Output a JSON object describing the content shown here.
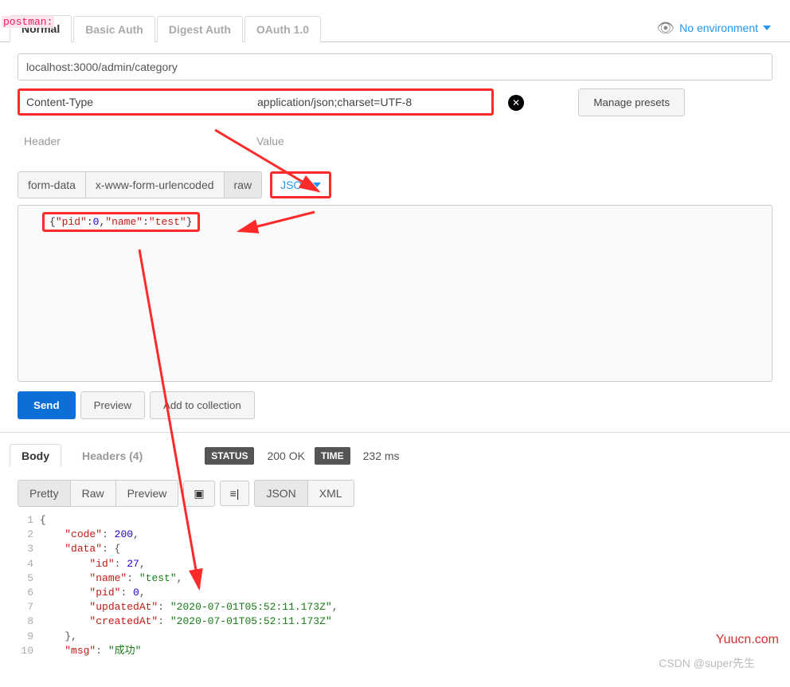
{
  "label": "postman:",
  "request_tabs": [
    "Normal",
    "Basic Auth",
    "Digest Auth",
    "OAuth 1.0"
  ],
  "env_label": "No environment",
  "url": "localhost:3000/admin/category",
  "header": {
    "key": "Content-Type",
    "value": "application/json;charset=UTF-8"
  },
  "placeholder": {
    "key": "Header",
    "value": "Value"
  },
  "manage_presets": "Manage presets",
  "body_types": [
    "form-data",
    "x-www-form-urlencoded",
    "raw"
  ],
  "body_format": "JSON",
  "body_raw_tokens": [
    {
      "t": "{",
      "c": "pun"
    },
    {
      "t": "\"pid\"",
      "c": "str"
    },
    {
      "t": ":",
      "c": "pun"
    },
    {
      "t": "0",
      "c": "num"
    },
    {
      "t": ",",
      "c": "pun"
    },
    {
      "t": "\"name\"",
      "c": "str"
    },
    {
      "t": ":",
      "c": "pun"
    },
    {
      "t": "\"test\"",
      "c": "str"
    },
    {
      "t": "}",
      "c": "pun"
    }
  ],
  "actions": {
    "send": "Send",
    "preview": "Preview",
    "add": "Add to collection"
  },
  "response_tabs": {
    "body": "Body",
    "headers": "Headers (4)"
  },
  "status": {
    "label": "STATUS",
    "value": "200 OK"
  },
  "time": {
    "label": "TIME",
    "value": "232 ms"
  },
  "view_modes": [
    "Pretty",
    "Raw",
    "Preview"
  ],
  "formats": [
    "JSON",
    "XML"
  ],
  "response_lines": [
    [
      {
        "t": "{",
        "c": "pun"
      }
    ],
    [
      {
        "t": "    ",
        "c": "pun"
      },
      {
        "t": "\"code\"",
        "c": "key"
      },
      {
        "t": ": ",
        "c": "pun"
      },
      {
        "t": "200",
        "c": "num"
      },
      {
        "t": ",",
        "c": "pun"
      }
    ],
    [
      {
        "t": "    ",
        "c": "pun"
      },
      {
        "t": "\"data\"",
        "c": "key"
      },
      {
        "t": ": {",
        "c": "pun"
      }
    ],
    [
      {
        "t": "        ",
        "c": "pun"
      },
      {
        "t": "\"id\"",
        "c": "key"
      },
      {
        "t": ": ",
        "c": "pun"
      },
      {
        "t": "27",
        "c": "num"
      },
      {
        "t": ",",
        "c": "pun"
      }
    ],
    [
      {
        "t": "        ",
        "c": "pun"
      },
      {
        "t": "\"name\"",
        "c": "key"
      },
      {
        "t": ": ",
        "c": "pun"
      },
      {
        "t": "\"test\"",
        "c": "str"
      },
      {
        "t": ",",
        "c": "pun"
      }
    ],
    [
      {
        "t": "        ",
        "c": "pun"
      },
      {
        "t": "\"pid\"",
        "c": "key"
      },
      {
        "t": ": ",
        "c": "pun"
      },
      {
        "t": "0",
        "c": "num"
      },
      {
        "t": ",",
        "c": "pun"
      }
    ],
    [
      {
        "t": "        ",
        "c": "pun"
      },
      {
        "t": "\"updatedAt\"",
        "c": "key"
      },
      {
        "t": ": ",
        "c": "pun"
      },
      {
        "t": "\"2020-07-01T05:52:11.173Z\"",
        "c": "str"
      },
      {
        "t": ",",
        "c": "pun"
      }
    ],
    [
      {
        "t": "        ",
        "c": "pun"
      },
      {
        "t": "\"createdAt\"",
        "c": "key"
      },
      {
        "t": ": ",
        "c": "pun"
      },
      {
        "t": "\"2020-07-01T05:52:11.173Z\"",
        "c": "str"
      }
    ],
    [
      {
        "t": "    },",
        "c": "pun"
      }
    ],
    [
      {
        "t": "    ",
        "c": "pun"
      },
      {
        "t": "\"msg\"",
        "c": "key"
      },
      {
        "t": ": ",
        "c": "pun"
      },
      {
        "t": "\"成功\"",
        "c": "str"
      }
    ]
  ],
  "watermark1": "Yuucn.com",
  "watermark2": "CSDN @super先生"
}
